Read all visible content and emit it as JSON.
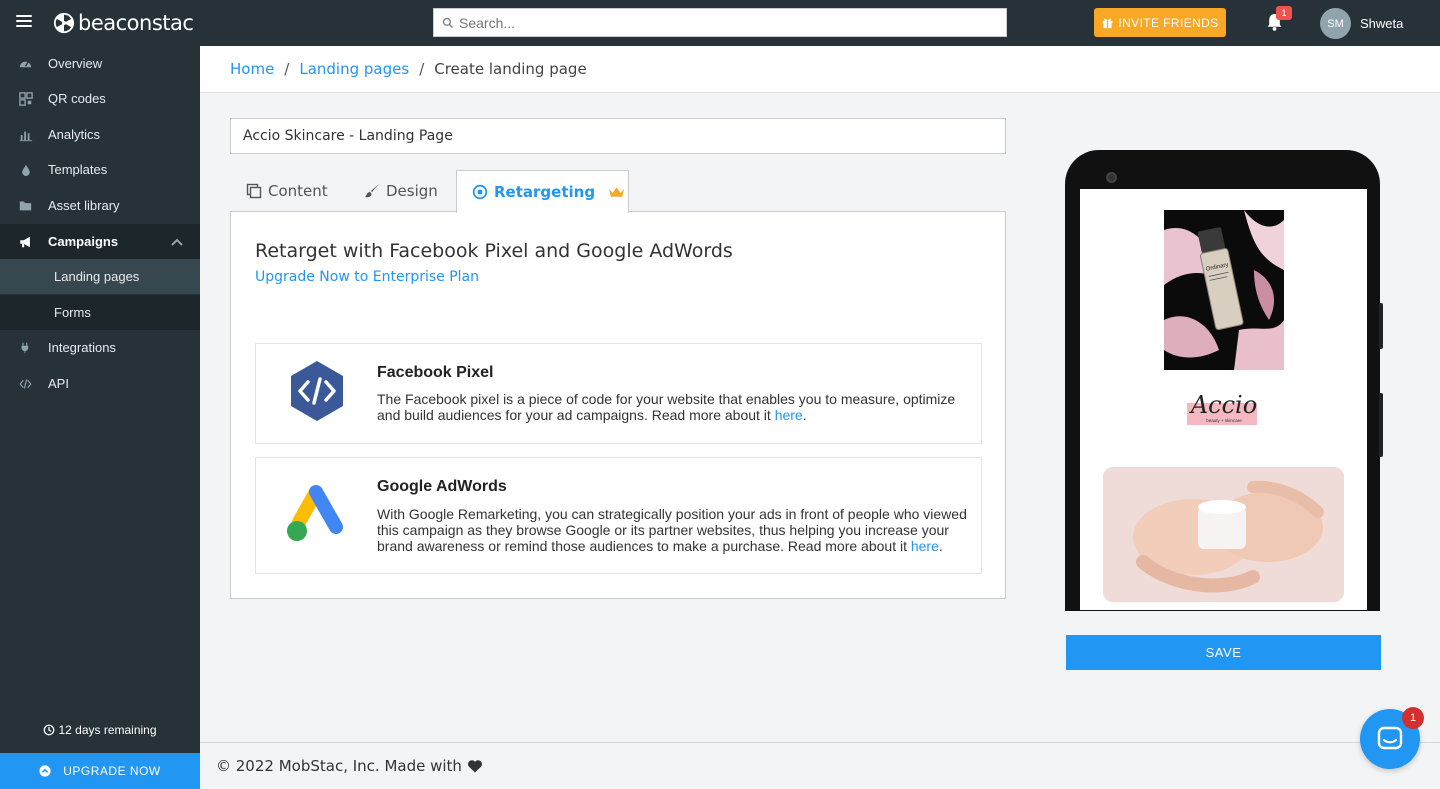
{
  "topbar": {
    "brand": "beaconstac",
    "search_placeholder": "Search...",
    "invite_label": "INVITE FRIENDS",
    "notification_count": "1",
    "avatar_initials": "SM",
    "username": "Shweta"
  },
  "sidebar": {
    "items": [
      {
        "label": "Overview",
        "icon": "dashboard-icon"
      },
      {
        "label": "QR codes",
        "icon": "qr-code-icon"
      },
      {
        "label": "Analytics",
        "icon": "bar-chart-icon"
      },
      {
        "label": "Templates",
        "icon": "drop-icon"
      },
      {
        "label": "Asset library",
        "icon": "folder-icon"
      },
      {
        "label": "Campaigns",
        "icon": "megaphone-icon"
      },
      {
        "label": "Integrations",
        "icon": "plug-icon"
      },
      {
        "label": "API",
        "icon": "code-icon"
      }
    ],
    "campaign_children": [
      {
        "label": "Landing pages"
      },
      {
        "label": "Forms"
      }
    ],
    "trial_text": "12 days remaining",
    "upgrade_label": "UPGRADE NOW"
  },
  "breadcrumb": {
    "home": "Home",
    "landing_pages": "Landing pages",
    "current": "Create landing page"
  },
  "editor": {
    "page_name": "Accio Skincare - Landing Page",
    "tabs": [
      {
        "label": "Content"
      },
      {
        "label": "Design"
      },
      {
        "label": "Retargeting"
      }
    ],
    "heading": "Retarget with Facebook Pixel and Google AdWords",
    "upgrade_link": "Upgrade Now to Enterprise Plan",
    "cards": [
      {
        "title": "Facebook Pixel",
        "description": "The Facebook pixel is a piece of code for your website that enables you to measure, optimize and build audiences for your ad campaigns. Read more about it ",
        "link": "here",
        "end": "."
      },
      {
        "title": "Google AdWords",
        "description": "With Google Remarketing, you can strategically position your ads in front of people who viewed this campaign as they browse Google or its partner websites, thus helping you increase your brand awareness or remind those audiences to make a purchase. Read more about it ",
        "link": "here",
        "end": "."
      }
    ]
  },
  "preview": {
    "brand_name": "Accio",
    "brand_tagline": "beauty + skincare",
    "product_label": "Ordinary"
  },
  "save_label": "SAVE",
  "footer": {
    "text": "© 2022 MobStac, Inc. Made with"
  },
  "chat": {
    "badge": "1"
  },
  "colors": {
    "primary": "#2196f3",
    "sidebar": "#263238",
    "invite": "#f9a825",
    "crown": "#f9a825"
  }
}
